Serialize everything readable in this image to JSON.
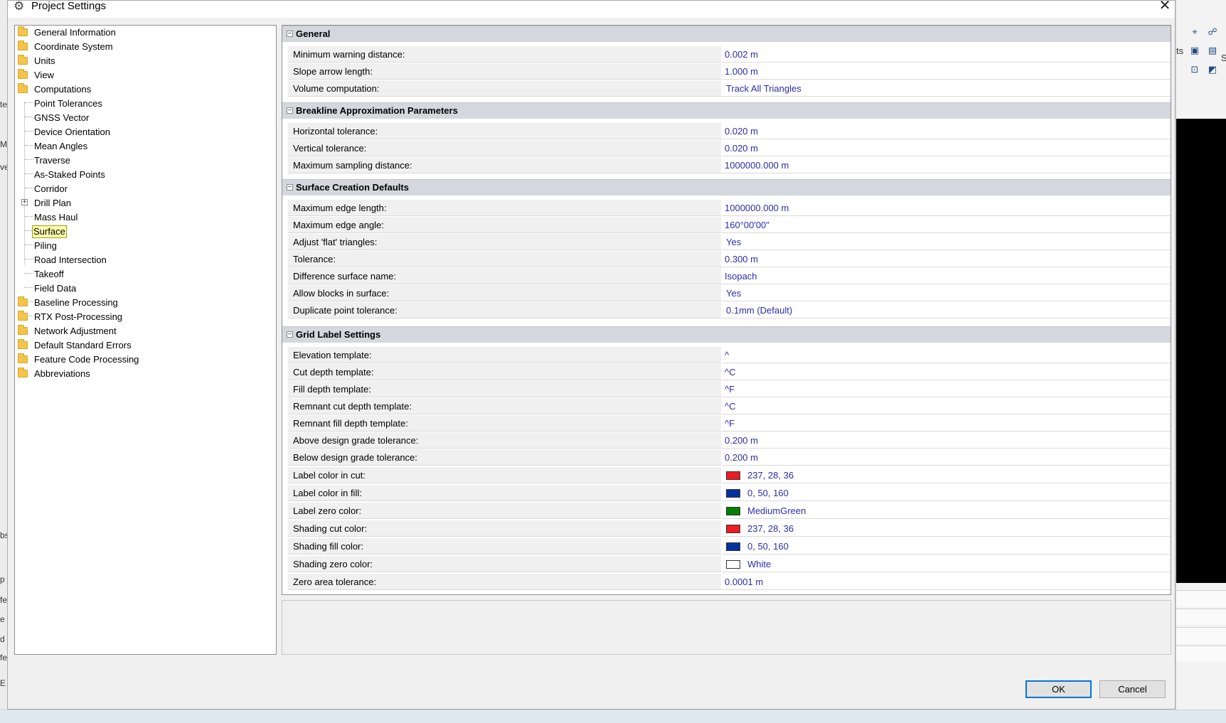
{
  "window": {
    "title": "Project Settings"
  },
  "tree": {
    "items": [
      "General Information",
      "Coordinate System",
      "Units",
      "View",
      "Computations",
      "Point Tolerances",
      "GNSS Vector",
      "Device Orientation",
      "Mean Angles",
      "Traverse",
      "As-Staked Points",
      "Corridor",
      "Drill Plan",
      "Mass Haul",
      "Surface",
      "Piling",
      "Road Intersection",
      "Takeoff",
      "Field Data",
      "Baseline Processing",
      "RTX Post-Processing",
      "Network Adjustment",
      "Default Standard Errors",
      "Feature Code Processing",
      "Abbreviations"
    ],
    "selected": "Surface",
    "expand_symbol": "+"
  },
  "grid": {
    "collapse_symbol": "−",
    "sections": [
      {
        "title": "General",
        "rows": [
          {
            "name": "Minimum warning distance:",
            "value": "0.002 m"
          },
          {
            "name": "Slope arrow length:",
            "value": "1.000 m"
          },
          {
            "name": "Volume computation:",
            "value": "Track All Triangles"
          }
        ]
      },
      {
        "title": "Breakline Approximation Parameters",
        "rows": [
          {
            "name": "Horizontal tolerance:",
            "value": "0.020 m"
          },
          {
            "name": "Vertical tolerance:",
            "value": "0.020 m"
          },
          {
            "name": "Maximum sampling distance:",
            "value": "1000000.000 m"
          }
        ]
      },
      {
        "title": "Surface Creation Defaults",
        "rows": [
          {
            "name": "Maximum edge length:",
            "value": "1000000.000 m"
          },
          {
            "name": "Maximum edge angle:",
            "value": "160°00'00\""
          },
          {
            "name": "Adjust 'flat' triangles:",
            "value": "Yes"
          },
          {
            "name": "Tolerance:",
            "value": "0.300 m"
          },
          {
            "name": "Difference surface name:",
            "value": "Isopach"
          },
          {
            "name": "Allow blocks in surface:",
            "value": "Yes"
          },
          {
            "name": "Duplicate point tolerance:",
            "value": "0.1mm (Default)"
          }
        ]
      },
      {
        "title": "Grid Label Settings",
        "rows": [
          {
            "name": "Elevation template:",
            "value": "^"
          },
          {
            "name": "Cut depth template:",
            "value": "^C"
          },
          {
            "name": "Fill depth template:",
            "value": "^F"
          },
          {
            "name": "Remnant cut depth template:",
            "value": "^C"
          },
          {
            "name": "Remnant fill depth template:",
            "value": "^F"
          },
          {
            "name": "Above design grade tolerance:",
            "value": "0.200 m"
          },
          {
            "name": "Below design grade tolerance:",
            "value": "0.200 m"
          },
          {
            "name": "Label color in cut:",
            "value": "237, 28, 36",
            "color": "#ed1c24"
          },
          {
            "name": "Label color in fill:",
            "value": "0, 50, 160",
            "color": "#0032a0"
          },
          {
            "name": "Label zero color:",
            "value": "MediumGreen",
            "color": "#008000"
          },
          {
            "name": "Shading cut color:",
            "value": "237, 28, 36",
            "color": "#ed1c24"
          },
          {
            "name": "Shading fill color:",
            "value": "0, 50, 160",
            "color": "#0032a0"
          },
          {
            "name": "Shading zero color:",
            "value": "White",
            "color": "#ffffff"
          },
          {
            "name": "Zero area tolerance:",
            "value": "0.0001 m"
          }
        ]
      }
    ]
  },
  "buttons": {
    "ok": "OK",
    "cancel": "Cancel"
  },
  "background": {
    "left_fragments": [
      "te",
      "M",
      "ve",
      "bs",
      "p",
      "fe",
      "e",
      "d",
      "fe",
      "E"
    ],
    "right_fragments": [
      "ts",
      "S"
    ]
  }
}
